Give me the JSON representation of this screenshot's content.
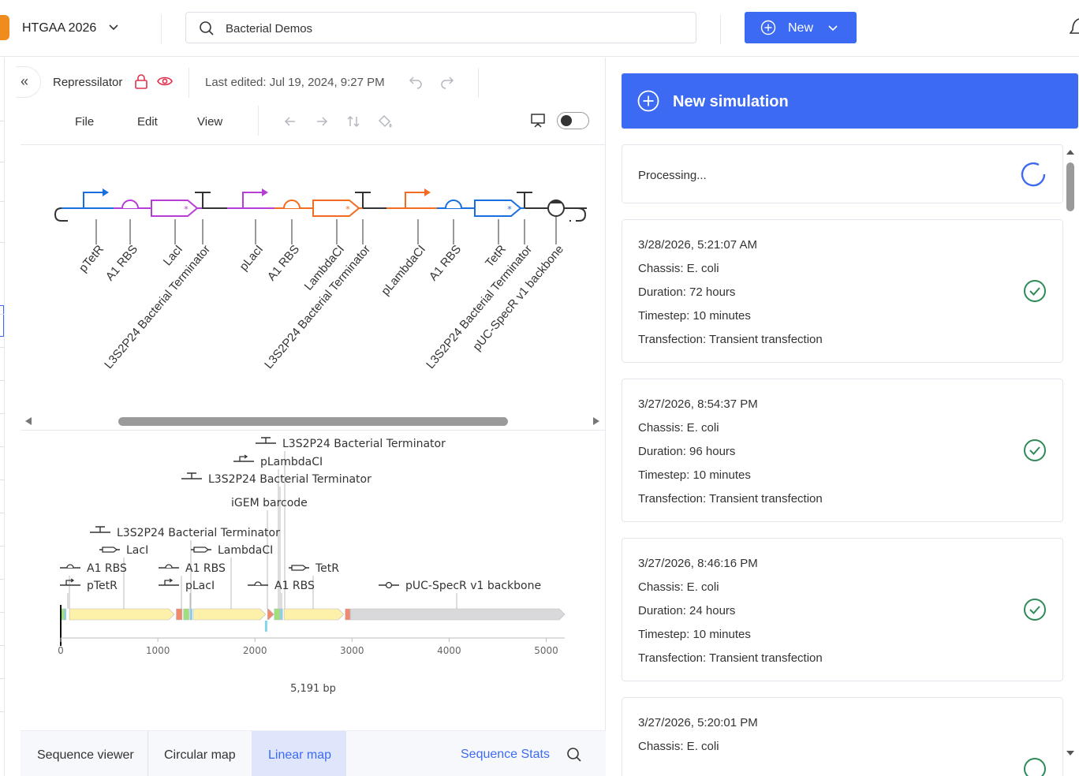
{
  "header": {
    "workspace": "HTGAA 2026",
    "search_value": "Bacterial Demos",
    "new_label": "New"
  },
  "document": {
    "title": "Repressilator",
    "last_edited": "Last edited: Jul 19, 2024, 9:27 PM"
  },
  "menu": [
    "File",
    "Edit",
    "View"
  ],
  "sbol_parts": [
    {
      "label": "pTetR",
      "type": "promoter",
      "color": "#1a6fe0"
    },
    {
      "label": "A1 RBS",
      "type": "rbs",
      "color": "#b63ed6"
    },
    {
      "label": "LacI",
      "type": "cds",
      "color": "#b63ed6"
    },
    {
      "label": "L3S2P24 Bacterial Terminator",
      "type": "terminator",
      "color": "#333333"
    },
    {
      "label": "pLacI",
      "type": "promoter",
      "color": "#b63ed6"
    },
    {
      "label": "A1 RBS",
      "type": "rbs",
      "color": "#f36c21"
    },
    {
      "label": "LambdaCI",
      "type": "cds",
      "color": "#f36c21"
    },
    {
      "label": "L3S2P24 Bacterial Terminator",
      "type": "terminator",
      "color": "#333333"
    },
    {
      "label": "pLambdaCI",
      "type": "promoter",
      "color": "#f36c21"
    },
    {
      "label": "A1 RBS",
      "type": "rbs",
      "color": "#1a6fe0"
    },
    {
      "label": "TetR",
      "type": "cds",
      "color": "#1a6fe0"
    },
    {
      "label": "L3S2P24 Bacterial Terminator",
      "type": "terminator",
      "color": "#333333"
    },
    {
      "label": "pUC-SpecR v1 backbone",
      "type": "origin",
      "color": "#333333"
    }
  ],
  "linear_map": {
    "length_label": "5,191 bp",
    "ticks": [
      "0",
      "1000",
      "2000",
      "3000",
      "4000",
      "5000"
    ],
    "features": [
      {
        "label": "L3S2P24 Bacterial Terminator",
        "icon": "terminator"
      },
      {
        "label": "pLambdaCI",
        "icon": "promoter"
      },
      {
        "label": "L3S2P24 Bacterial Terminator",
        "icon": "terminator"
      },
      {
        "label": "iGEM barcode",
        "icon": "none"
      },
      {
        "label": "L3S2P24 Bacterial Terminator",
        "icon": "terminator"
      },
      {
        "label": "LacI",
        "icon": "cds"
      },
      {
        "label": "LambdaCI",
        "icon": "cds"
      },
      {
        "label": "A1 RBS",
        "icon": "rbs"
      },
      {
        "label": "A1 RBS",
        "icon": "rbs"
      },
      {
        "label": "TetR",
        "icon": "cds"
      },
      {
        "label": "pTetR",
        "icon": "promoter"
      },
      {
        "label": "pLacI",
        "icon": "promoter"
      },
      {
        "label": "A1 RBS",
        "icon": "rbs"
      },
      {
        "label": "pUC-SpecR v1 backbone",
        "icon": "origin"
      }
    ]
  },
  "bottom_tabs": [
    "Sequence viewer",
    "Circular map",
    "Linear map"
  ],
  "active_tab": "Linear map",
  "sequence_stats": "Sequence Stats",
  "simulation": {
    "new_label": "New simulation",
    "processing": "Processing...",
    "runs": [
      {
        "time": "3/28/2026, 5:21:07 AM",
        "chassis": "Chassis: E. coli",
        "duration": "Duration: 72 hours",
        "timestep": "Timestep: 10 minutes",
        "transfection": "Transfection: Transient transfection"
      },
      {
        "time": "3/27/2026, 8:54:37 PM",
        "chassis": "Chassis: E. coli",
        "duration": "Duration: 96 hours",
        "timestep": "Timestep: 10 minutes",
        "transfection": "Transfection: Transient transfection"
      },
      {
        "time": "3/27/2026, 8:46:16 PM",
        "chassis": "Chassis: E. coli",
        "duration": "Duration: 24 hours",
        "timestep": "Timestep: 10 minutes",
        "transfection": "Transfection: Transient transfection"
      },
      {
        "time": "3/27/2026, 5:20:01 PM",
        "chassis": "Chassis: E. coli"
      }
    ]
  },
  "colors": {
    "accent": "#3d6af2",
    "success": "#2e8b57",
    "cds_fill": "#fdf0a8",
    "backbone_fill": "#d9d9dc"
  }
}
